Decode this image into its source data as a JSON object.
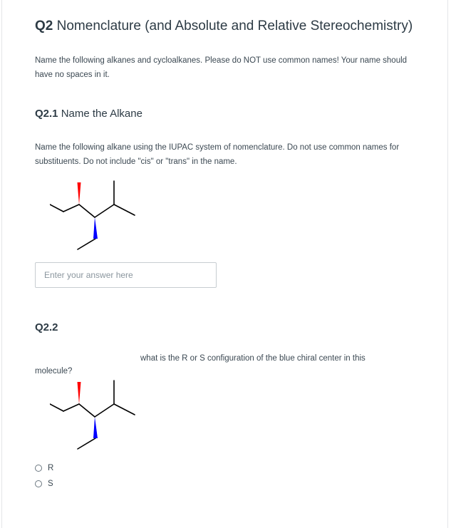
{
  "question": {
    "number": "Q2",
    "title": "Nomenclature (and Absolute and Relative Stereochemistry)",
    "intro": "Name the following alkanes and cycloalkanes.  Please do NOT use common names!  Your name should have no spaces in it."
  },
  "q21": {
    "number": "Q2.1",
    "title": "Name the Alkane",
    "instructions": "Name the following alkane using the IUPAC system of nomenclature.  Do not use common names for substituents. Do not include \"cis\" or \"trans\" in the name.",
    "answer_placeholder": "Enter your answer here",
    "answer_value": ""
  },
  "q22": {
    "number": "Q2.2",
    "text_part1": "what is the R or S configuration of the blue chiral center in this",
    "text_part2": "molecule?",
    "options": [
      "R",
      "S"
    ],
    "selected": null
  },
  "colors": {
    "wedge_red": "#ff0000",
    "wedge_blue": "#0000ff",
    "text": "#2d3b45",
    "border": "#c7cdd1"
  }
}
